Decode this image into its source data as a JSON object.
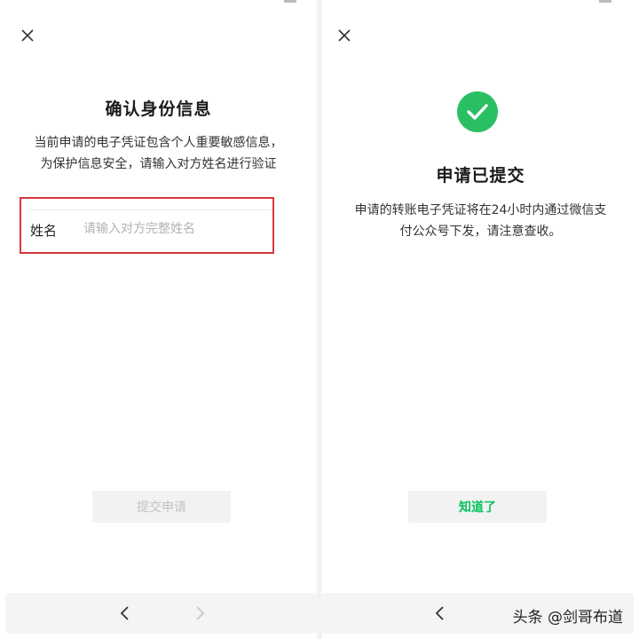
{
  "left_screen": {
    "close_icon": "close-icon",
    "title": "确认身份信息",
    "description_lines": [
      "当前申请的电子凭证包含个人重要敏感信息，",
      "为保护信息安全，请输入对方姓名进行验证"
    ],
    "name_field": {
      "label": "姓名",
      "value": "",
      "placeholder": "请输入对方完整姓名"
    },
    "submit_button": "提交申请",
    "nav": {
      "back_icon": "chevron-left-icon",
      "forward_icon": "chevron-right-icon"
    }
  },
  "right_screen": {
    "close_icon": "close-icon",
    "status_icon": "check-circle-icon",
    "title": "申请已提交",
    "description_lines": [
      "申请的转账电子凭证将在24小时内通过微信支",
      "付公众号下发，请注意查收。"
    ],
    "ok_button": "知道了",
    "nav": {
      "back_icon": "chevron-left-icon"
    }
  },
  "watermark": "头条 @剑哥布道",
  "colors": {
    "highlight_border": "#d9373e",
    "success_green": "#2bbf63",
    "ok_text": "#07c160"
  }
}
